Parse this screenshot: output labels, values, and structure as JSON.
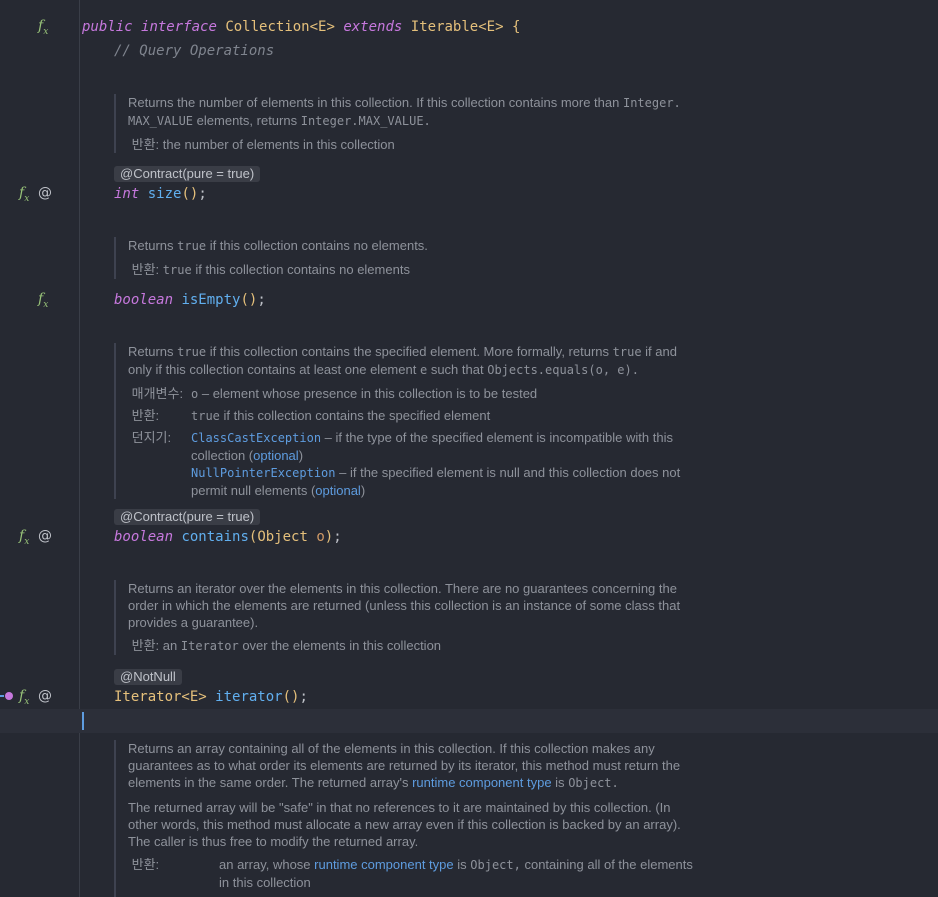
{
  "header": {
    "line": [
      "public",
      "interface",
      "Collection<E>",
      "extends",
      "Iterable<E>",
      "{"
    ],
    "comment": "// Query Operations"
  },
  "size_doc": {
    "line1": "Returns the number of elements in this collection. If this collection contains more than",
    "mono1": "Integer.",
    "mono2": "MAX_VALUE",
    "line2": "elements, returns",
    "mono3": "Integer.MAX_VALUE.",
    "returns_label": "반환:",
    "returns": "the number of elements in this collection"
  },
  "annotation_contract": "@Contract(pure = true)",
  "annotation_notnull": "@NotNull",
  "size_sig": {
    "ret": "int",
    "name": "size",
    "parens": "()",
    "end": ";"
  },
  "isempty_doc": {
    "pre": "Returns",
    "mono": "true",
    "post": "if this collection contains no elements.",
    "returns_label": "반환:",
    "returns_mono": "true",
    "returns": "if this collection contains no elements"
  },
  "isempty_sig": {
    "ret": "boolean",
    "name": "isEmpty",
    "parens": "()",
    "end": ";"
  },
  "contains_doc": {
    "p1a": "Returns",
    "p1mono": "true",
    "p1b": "if this collection contains the specified element. More formally, returns",
    "p1mono2": "true",
    "p1c": "if and",
    "p2a": "only if this collection contains at least one element",
    "p2mono": "e",
    "p2b": "such that",
    "p2mono2": "Objects.equals(o, e).",
    "param_label": "매개변수:",
    "param_name": "o",
    "param_text": "– element whose presence in this collection is to be tested",
    "returns_label": "반환:",
    "returns_mono": "true",
    "returns": "if this collection contains the specified element",
    "throws_label": "던지기:",
    "ex1": "ClassCastException",
    "ex1_text": "– if the type of the specified element is incompatible with this",
    "ex1_text2": "collection (",
    "optional": "optional",
    "close": ")",
    "ex2": "NullPointerException",
    "ex2_text": "– if the specified element is null and this collection does not",
    "ex2_text2": "permit null elements ("
  },
  "contains_sig": {
    "ret": "boolean",
    "name": "contains",
    "open": "(",
    "ptype": "Object",
    "pname": "o",
    "close": ")",
    "end": ";"
  },
  "iterator_doc": {
    "l1": "Returns an iterator over the elements in this collection. There are no guarantees concerning the",
    "l2": "order in which the elements are returned (unless this collection is an instance of some class that",
    "l3": "provides a guarantee).",
    "returns_label": "반환:",
    "returns_a": "an",
    "returns_mono": "Iterator",
    "returns_b": "over the elements in this collection"
  },
  "iterator_sig": {
    "ret": "Iterator<E>",
    "name": "iterator",
    "parens": "()",
    "end": ";"
  },
  "toarray_doc": {
    "l1": "Returns an array containing all of the elements in this collection. If this collection makes any",
    "l2": "guarantees as to what order its elements are returned by its iterator, this method must return the",
    "l3a": "elements in the same order. The returned array's",
    "l3link": "runtime component type",
    "l3b": "is",
    "l3mono": "Object.",
    "p2l1": "The returned array will be \"safe\" in that no references to it are maintained by this collection. (In",
    "p2l2": "other words, this method must allocate a new array even if this collection is backed by an array).",
    "p2l3": "The caller is thus free to modify the returned array.",
    "returns_label": "반환:",
    "ret_a": "an array, whose",
    "ret_link": "runtime component type",
    "ret_b": "is",
    "ret_mono": "Object,",
    "ret_c": "containing all of the elements",
    "ret_d": "in this collection"
  },
  "gutter": {
    "fx": "f",
    "x": "x",
    "at": "@"
  },
  "colors": {
    "bg": "#262932",
    "keyword": "#c678dd",
    "type": "#e5c07b",
    "function": "#61afef",
    "link": "#5e9cdf",
    "gutter_icon": "#98c379"
  }
}
